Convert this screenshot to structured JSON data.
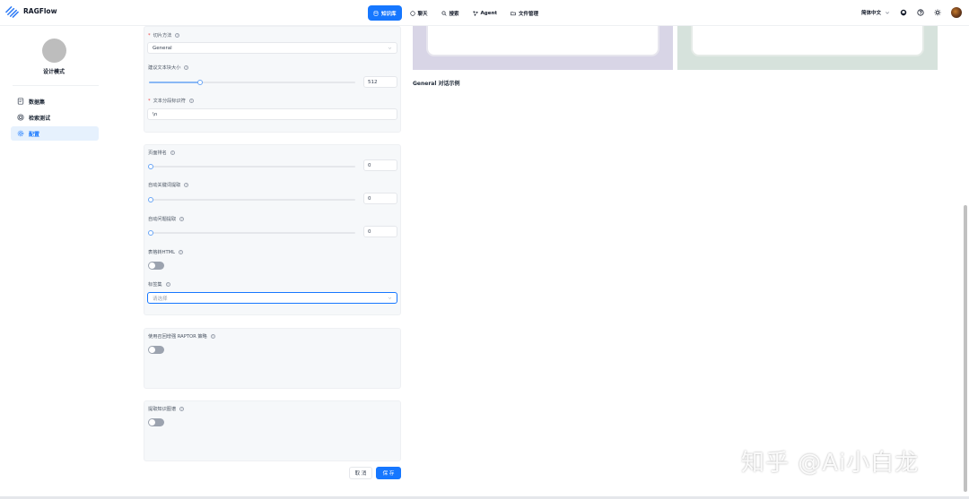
{
  "app": {
    "name": "RAGFlow"
  },
  "nav": [
    {
      "label": "知识库",
      "icon": "database-icon",
      "active": true
    },
    {
      "label": "聊天",
      "icon": "chat-icon",
      "active": false
    },
    {
      "label": "搜索",
      "icon": "search-icon",
      "active": false
    },
    {
      "label": "Agent",
      "icon": "agent-icon",
      "active": false
    },
    {
      "label": "文件管理",
      "icon": "folder-icon",
      "active": false
    }
  ],
  "topbar": {
    "language": "简体中文"
  },
  "sidebar": {
    "title": "设计模式",
    "items": [
      {
        "label": "数据集",
        "icon": "dataset-icon",
        "active": false
      },
      {
        "label": "检索测试",
        "icon": "retrieval-test-icon",
        "active": false
      },
      {
        "label": "配置",
        "icon": "gear-icon",
        "active": true
      }
    ]
  },
  "form": {
    "chunk_method": {
      "label": "切片方法",
      "value": "General"
    },
    "chunk_token_num": {
      "label": "建议文本块大小",
      "value": "512",
      "fraction": 0.248
    },
    "delimiter": {
      "label": "文本分段标识符",
      "value": "\\n"
    },
    "page_rank": {
      "label": "页面排名",
      "value": "0"
    },
    "auto_keywords": {
      "label": "自动关键词提取",
      "value": "0"
    },
    "auto_questions": {
      "label": "自动问题提取",
      "value": "0"
    },
    "html4excel": {
      "label": "表格转HTML",
      "value": false
    },
    "tag_sets": {
      "label": "标签集",
      "placeholder": "请选择"
    },
    "raptor": {
      "label": "使用召回增强 RAPTOR 策略",
      "value": false
    },
    "graphrag": {
      "label": "提取知识图谱",
      "value": false
    }
  },
  "buttons": {
    "cancel": "取 消",
    "save": "保 存"
  },
  "preview": {
    "title": "General 对话示例"
  },
  "watermark": "知乎 @Ai小白龙",
  "colors": {
    "accent": "#1677ff",
    "sidebar_active_bg": "#e6f1fd"
  }
}
